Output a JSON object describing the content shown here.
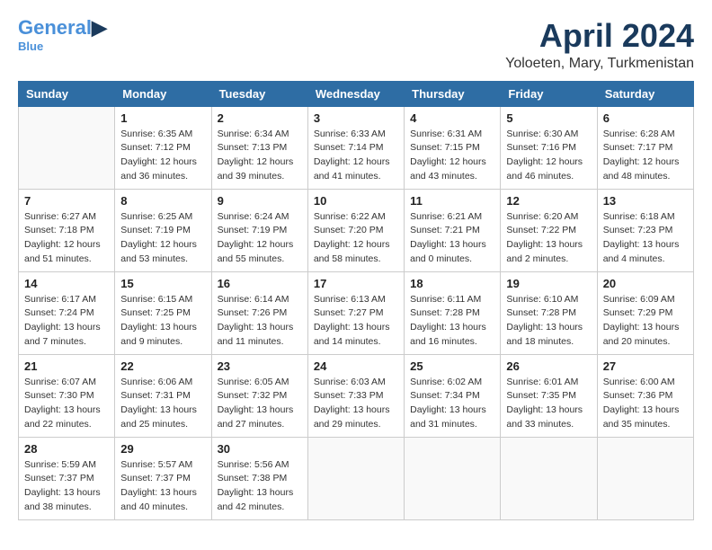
{
  "logo": {
    "line1": "General",
    "line2": "Blue"
  },
  "title": {
    "month_year": "April 2024",
    "location": "Yoloeten, Mary, Turkmenistan"
  },
  "headers": [
    "Sunday",
    "Monday",
    "Tuesday",
    "Wednesday",
    "Thursday",
    "Friday",
    "Saturday"
  ],
  "weeks": [
    [
      {
        "day": "",
        "info": ""
      },
      {
        "day": "1",
        "info": "Sunrise: 6:35 AM\nSunset: 7:12 PM\nDaylight: 12 hours\nand 36 minutes."
      },
      {
        "day": "2",
        "info": "Sunrise: 6:34 AM\nSunset: 7:13 PM\nDaylight: 12 hours\nand 39 minutes."
      },
      {
        "day": "3",
        "info": "Sunrise: 6:33 AM\nSunset: 7:14 PM\nDaylight: 12 hours\nand 41 minutes."
      },
      {
        "day": "4",
        "info": "Sunrise: 6:31 AM\nSunset: 7:15 PM\nDaylight: 12 hours\nand 43 minutes."
      },
      {
        "day": "5",
        "info": "Sunrise: 6:30 AM\nSunset: 7:16 PM\nDaylight: 12 hours\nand 46 minutes."
      },
      {
        "day": "6",
        "info": "Sunrise: 6:28 AM\nSunset: 7:17 PM\nDaylight: 12 hours\nand 48 minutes."
      }
    ],
    [
      {
        "day": "7",
        "info": "Sunrise: 6:27 AM\nSunset: 7:18 PM\nDaylight: 12 hours\nand 51 minutes."
      },
      {
        "day": "8",
        "info": "Sunrise: 6:25 AM\nSunset: 7:19 PM\nDaylight: 12 hours\nand 53 minutes."
      },
      {
        "day": "9",
        "info": "Sunrise: 6:24 AM\nSunset: 7:19 PM\nDaylight: 12 hours\nand 55 minutes."
      },
      {
        "day": "10",
        "info": "Sunrise: 6:22 AM\nSunset: 7:20 PM\nDaylight: 12 hours\nand 58 minutes."
      },
      {
        "day": "11",
        "info": "Sunrise: 6:21 AM\nSunset: 7:21 PM\nDaylight: 13 hours\nand 0 minutes."
      },
      {
        "day": "12",
        "info": "Sunrise: 6:20 AM\nSunset: 7:22 PM\nDaylight: 13 hours\nand 2 minutes."
      },
      {
        "day": "13",
        "info": "Sunrise: 6:18 AM\nSunset: 7:23 PM\nDaylight: 13 hours\nand 4 minutes."
      }
    ],
    [
      {
        "day": "14",
        "info": "Sunrise: 6:17 AM\nSunset: 7:24 PM\nDaylight: 13 hours\nand 7 minutes."
      },
      {
        "day": "15",
        "info": "Sunrise: 6:15 AM\nSunset: 7:25 PM\nDaylight: 13 hours\nand 9 minutes."
      },
      {
        "day": "16",
        "info": "Sunrise: 6:14 AM\nSunset: 7:26 PM\nDaylight: 13 hours\nand 11 minutes."
      },
      {
        "day": "17",
        "info": "Sunrise: 6:13 AM\nSunset: 7:27 PM\nDaylight: 13 hours\nand 14 minutes."
      },
      {
        "day": "18",
        "info": "Sunrise: 6:11 AM\nSunset: 7:28 PM\nDaylight: 13 hours\nand 16 minutes."
      },
      {
        "day": "19",
        "info": "Sunrise: 6:10 AM\nSunset: 7:28 PM\nDaylight: 13 hours\nand 18 minutes."
      },
      {
        "day": "20",
        "info": "Sunrise: 6:09 AM\nSunset: 7:29 PM\nDaylight: 13 hours\nand 20 minutes."
      }
    ],
    [
      {
        "day": "21",
        "info": "Sunrise: 6:07 AM\nSunset: 7:30 PM\nDaylight: 13 hours\nand 22 minutes."
      },
      {
        "day": "22",
        "info": "Sunrise: 6:06 AM\nSunset: 7:31 PM\nDaylight: 13 hours\nand 25 minutes."
      },
      {
        "day": "23",
        "info": "Sunrise: 6:05 AM\nSunset: 7:32 PM\nDaylight: 13 hours\nand 27 minutes."
      },
      {
        "day": "24",
        "info": "Sunrise: 6:03 AM\nSunset: 7:33 PM\nDaylight: 13 hours\nand 29 minutes."
      },
      {
        "day": "25",
        "info": "Sunrise: 6:02 AM\nSunset: 7:34 PM\nDaylight: 13 hours\nand 31 minutes."
      },
      {
        "day": "26",
        "info": "Sunrise: 6:01 AM\nSunset: 7:35 PM\nDaylight: 13 hours\nand 33 minutes."
      },
      {
        "day": "27",
        "info": "Sunrise: 6:00 AM\nSunset: 7:36 PM\nDaylight: 13 hours\nand 35 minutes."
      }
    ],
    [
      {
        "day": "28",
        "info": "Sunrise: 5:59 AM\nSunset: 7:37 PM\nDaylight: 13 hours\nand 38 minutes."
      },
      {
        "day": "29",
        "info": "Sunrise: 5:57 AM\nSunset: 7:37 PM\nDaylight: 13 hours\nand 40 minutes."
      },
      {
        "day": "30",
        "info": "Sunrise: 5:56 AM\nSunset: 7:38 PM\nDaylight: 13 hours\nand 42 minutes."
      },
      {
        "day": "",
        "info": ""
      },
      {
        "day": "",
        "info": ""
      },
      {
        "day": "",
        "info": ""
      },
      {
        "day": "",
        "info": ""
      }
    ]
  ]
}
